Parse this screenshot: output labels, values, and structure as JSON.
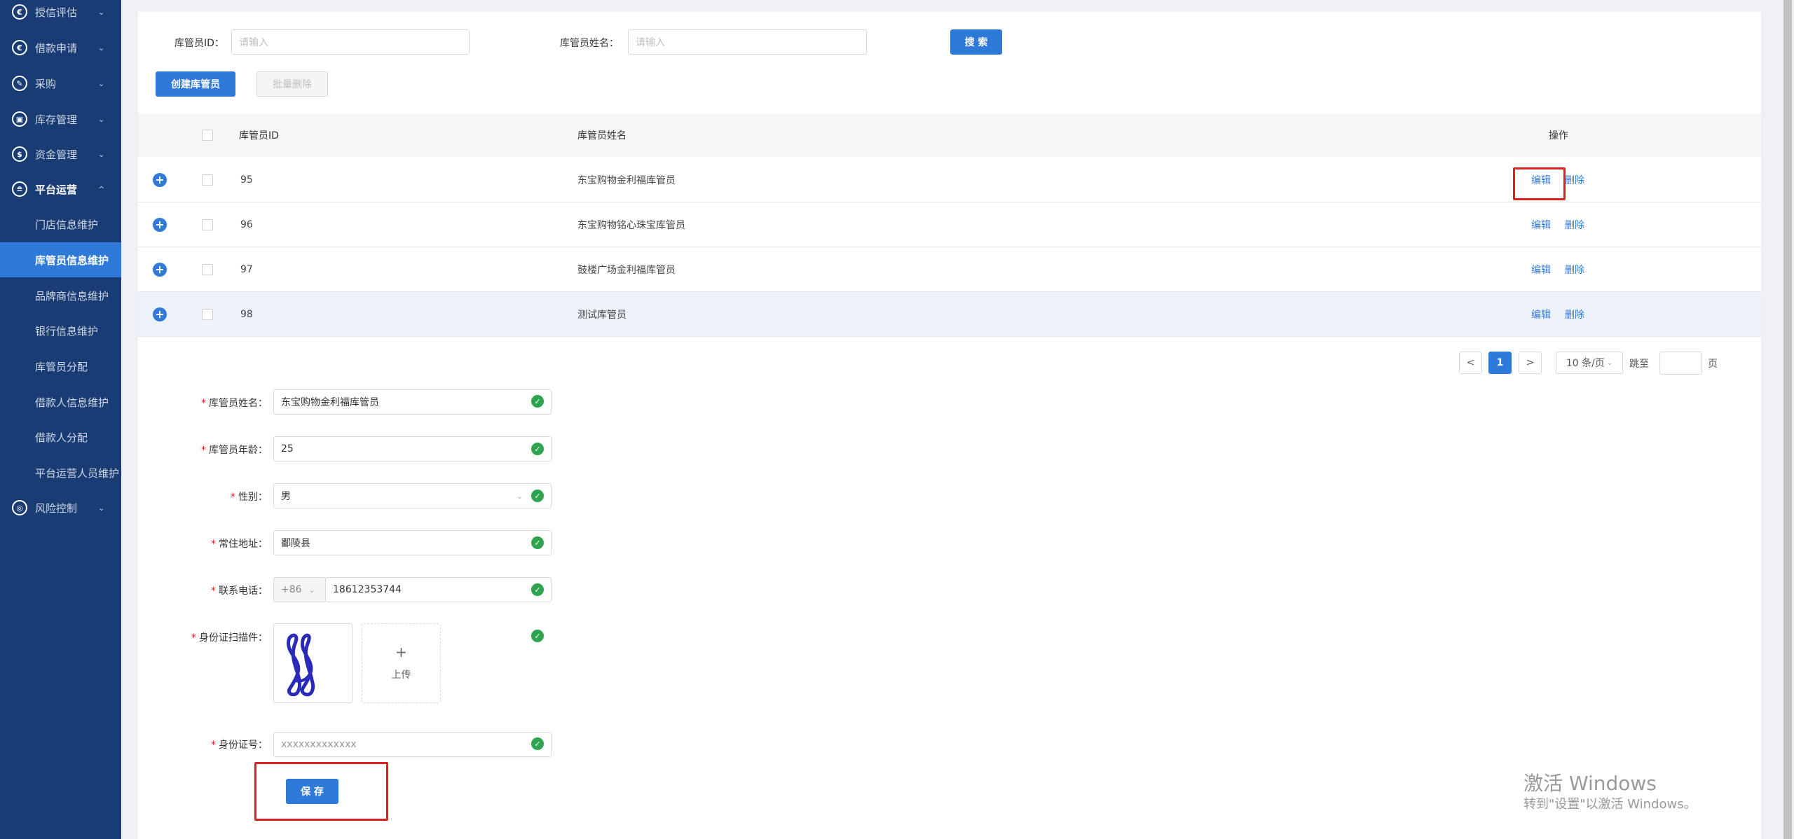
{
  "sidebar": {
    "items": [
      {
        "icon": "€",
        "label": "授信评估",
        "chevron": "⌄"
      },
      {
        "icon": "€",
        "label": "借款申请",
        "chevron": "⌄"
      },
      {
        "icon": "✎",
        "label": "采购",
        "chevron": "⌄"
      },
      {
        "icon": "▣",
        "label": "库存管理",
        "chevron": "⌄"
      },
      {
        "icon": "$",
        "label": "资金管理",
        "chevron": "⌄"
      },
      {
        "icon": "≘",
        "label": "平台运营",
        "chevron": "^"
      },
      {
        "icon": "◎",
        "label": "风险控制",
        "chevron": "⌄"
      }
    ],
    "submenu": [
      "门店信息维护",
      "库管员信息维护",
      "品牌商信息维护",
      "银行信息维护",
      "库管员分配",
      "借款人信息维护",
      "借款人分配",
      "平台运营人员维护"
    ]
  },
  "search": {
    "id_label": "库管员ID：",
    "id_placeholder": "请输入",
    "name_label": "库管员姓名：",
    "name_placeholder": "请输入",
    "search_button": "搜 索"
  },
  "toolbar": {
    "create_button": "创建库管员",
    "batch_delete_button": "批量删除"
  },
  "table": {
    "headers": {
      "id": "库管员ID",
      "name": "库管员姓名",
      "actions": "操作"
    },
    "rows": [
      {
        "id": "95",
        "name": "东宝购物金利福库管员",
        "edit": "编辑",
        "delete": "删除"
      },
      {
        "id": "96",
        "name": "东宝购物铭心珠宝库管员",
        "edit": "编辑",
        "delete": "删除"
      },
      {
        "id": "97",
        "name": "鼓楼广场金利福库管员",
        "edit": "编辑",
        "delete": "删除"
      },
      {
        "id": "98",
        "name": "测试库管员",
        "edit": "编辑",
        "delete": "删除"
      }
    ]
  },
  "pagination": {
    "prev": "<",
    "current": "1",
    "next": ">",
    "page_size": "10 条/页",
    "jump_label": "跳至",
    "page_suffix": "页"
  },
  "form": {
    "name_label": "库管员姓名：",
    "name_value": "东宝购物金利福库管员",
    "age_label": "库管员年龄：",
    "age_value": "25",
    "gender_label": "性别：",
    "gender_value": "男",
    "address_label": "常住地址：",
    "address_value": "鄱陵县",
    "phone_label": "联系电话：",
    "phone_prefix": "+86",
    "phone_value": "18612353744",
    "idscan_label": "身份证扫描件：",
    "upload_plus": "+",
    "upload_label": "上传",
    "idnum_label": "身份证号：",
    "idnum_value": "xxxxxxxxxxxxx",
    "save_button": "保 存"
  },
  "watermark": {
    "line1": "激活 Windows",
    "line2": "转到\"设置\"以激活 Windows。"
  },
  "colors": {
    "sidebar_bg": "#1a3c74",
    "accent": "#2f7ad9",
    "success": "#2ea44f",
    "highlight_box": "#e02020"
  }
}
